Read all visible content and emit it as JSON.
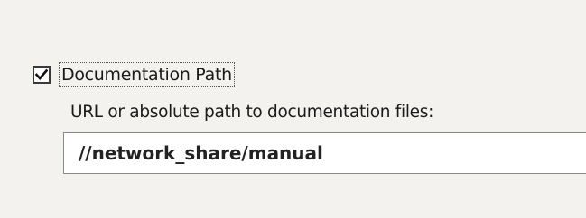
{
  "documentation": {
    "checkbox_label": "Documentation Path",
    "checked": true,
    "description": "URL or absolute path to documentation files:",
    "path_value": "//network_share/manual"
  },
  "icons": {
    "checkmark": "check-icon"
  }
}
